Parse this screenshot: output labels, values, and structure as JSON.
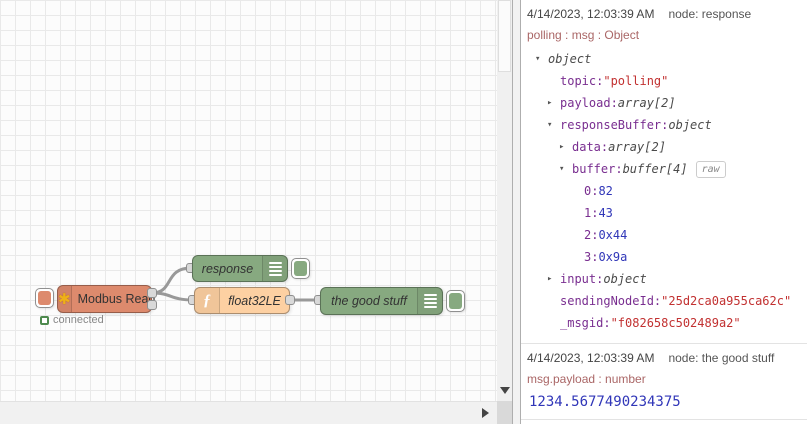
{
  "canvas": {
    "nodes": {
      "modbus": {
        "label": "Modbus Read",
        "status": "connected"
      },
      "response": {
        "label": "response"
      },
      "func": {
        "label": "float32LE",
        "icon_glyph": "ƒ"
      },
      "goodstuff": {
        "label": "the good stuff"
      }
    },
    "modbus_icon_glyph": "✱",
    "colors": {
      "modbus_node": "#dd8a6d",
      "debug_node": "#87a980",
      "function_node": "#fdd0a2",
      "wire": "#999999",
      "status_ok": "#4e8a4e",
      "meta_text": "#aa6666",
      "key_text": "#792e90",
      "string_value": "#c23131",
      "number_value": "#3036b8"
    }
  },
  "debug": {
    "raw_label": "raw",
    "messages": [
      {
        "timestamp": "4/14/2023, 12:03:39 AM",
        "node": "node: response",
        "meta": "polling : msg : Object",
        "tree": [
          {
            "level": 0,
            "expander": "open",
            "key": "",
            "value": "object",
            "value_class": "type"
          },
          {
            "level": 1,
            "expander": null,
            "key": "topic",
            "value": "\"polling\"",
            "value_class": "string"
          },
          {
            "level": 1,
            "expander": "closed",
            "key": "payload",
            "value": "array[2]",
            "value_class": "type"
          },
          {
            "level": 1,
            "expander": "open",
            "key": "responseBuffer",
            "value": "object",
            "value_class": "type"
          },
          {
            "level": 2,
            "expander": "closed",
            "key": "data",
            "value": "array[2]",
            "value_class": "type"
          },
          {
            "level": 2,
            "expander": "open",
            "key": "buffer",
            "value": "buffer[4]",
            "value_class": "type",
            "raw": true
          },
          {
            "level": 3,
            "expander": null,
            "key": "0",
            "value": "82",
            "value_class": "number"
          },
          {
            "level": 3,
            "expander": null,
            "key": "1",
            "value": "43",
            "value_class": "number"
          },
          {
            "level": 3,
            "expander": null,
            "key": "2",
            "value": "0x44",
            "value_class": "number"
          },
          {
            "level": 3,
            "expander": null,
            "key": "3",
            "value": "0x9a",
            "value_class": "number"
          },
          {
            "level": 1,
            "expander": "closed",
            "key": "input",
            "value": "object",
            "value_class": "type"
          },
          {
            "level": 1,
            "expander": null,
            "key": "sendingNodeId",
            "value": "\"25d2ca0a955ca62c\"",
            "value_class": "string"
          },
          {
            "level": 1,
            "expander": null,
            "key": "_msgid",
            "value": "\"f082658c502489a2\"",
            "value_class": "string"
          }
        ]
      },
      {
        "timestamp": "4/14/2023, 12:03:39 AM",
        "node": "node: the good stuff",
        "meta": "msg.payload : number",
        "payload": "1234.5677490234375"
      }
    ]
  }
}
